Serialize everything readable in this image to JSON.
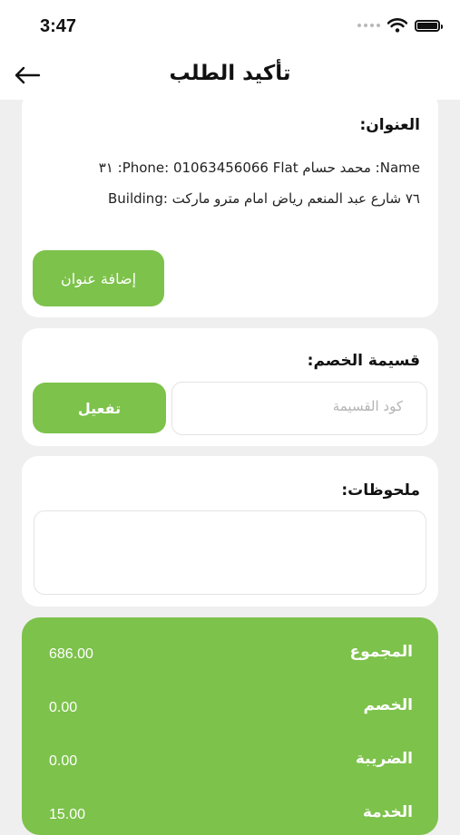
{
  "status_bar": {
    "time": "3:47"
  },
  "header": {
    "title": "تأكيد الطلب"
  },
  "address_card": {
    "title": "العنوان:",
    "line1": "Name: محمد حسام   Phone: 01063456066  Flat: ٣١",
    "line2": "٧٦ شارع عبد المنعم رياض امام مترو ماركت :Building",
    "add_button": "إضافة عنوان"
  },
  "coupon_card": {
    "title": "قسيمة الخصم:",
    "placeholder": "كود القسيمة",
    "activate_button": "تفعيل"
  },
  "notes_card": {
    "title": "ملحوظات:"
  },
  "summary": {
    "rows": [
      {
        "label": "المجموع",
        "value": "686.00"
      },
      {
        "label": "الخصم",
        "value": "0.00"
      },
      {
        "label": "الضريبة",
        "value": "0.00"
      },
      {
        "label": "الخدمة",
        "value": "15.00"
      }
    ]
  },
  "colors": {
    "accent": "#7dc24b",
    "background": "#efefef"
  }
}
